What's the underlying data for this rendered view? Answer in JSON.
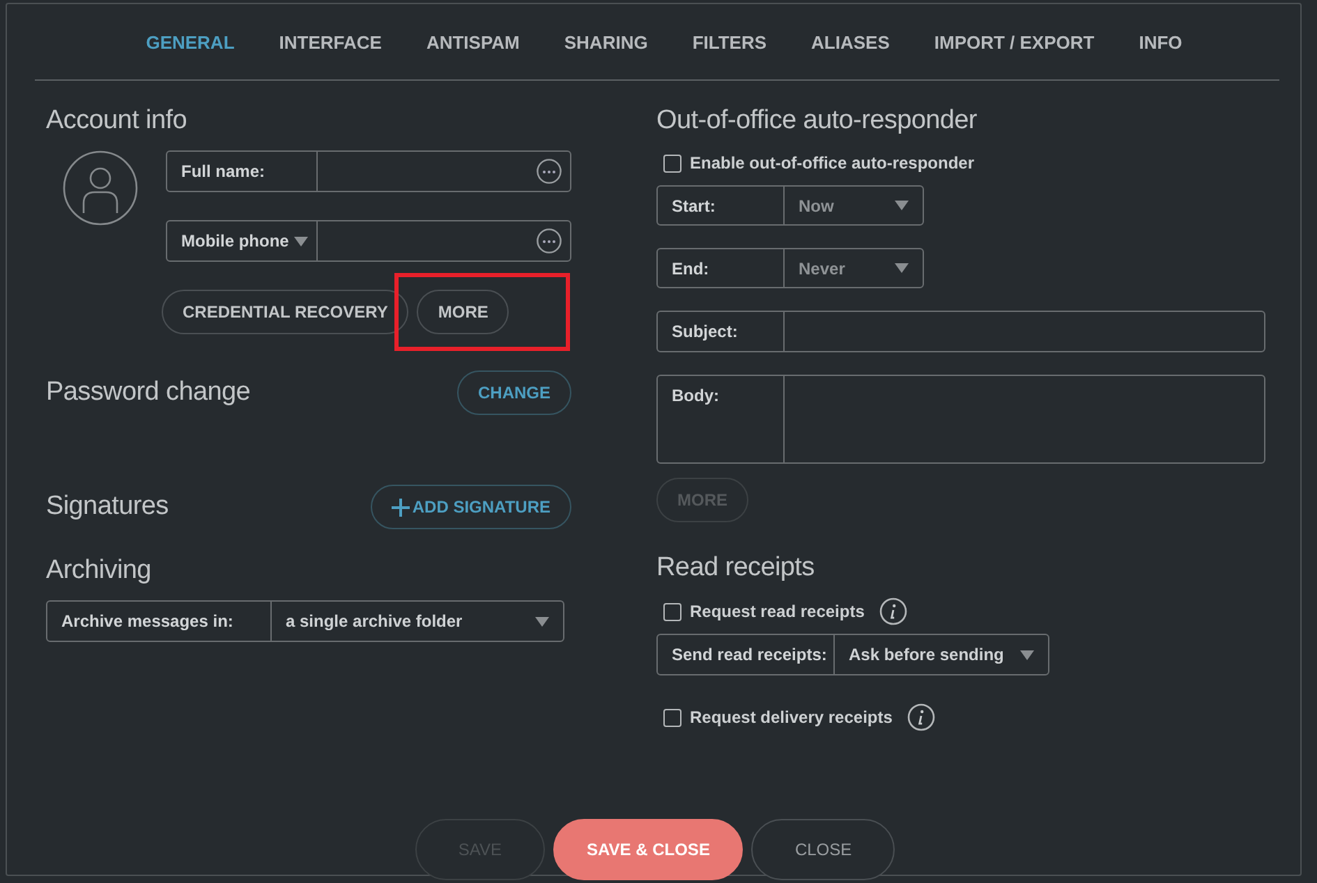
{
  "tabs": [
    {
      "label": "GENERAL",
      "selected": true
    },
    {
      "label": "INTERFACE",
      "selected": false
    },
    {
      "label": "ANTISPAM",
      "selected": false
    },
    {
      "label": "SHARING",
      "selected": false
    },
    {
      "label": "FILTERS",
      "selected": false
    },
    {
      "label": "ALIASES",
      "selected": false
    },
    {
      "label": "IMPORT / EXPORT",
      "selected": false
    },
    {
      "label": "INFO",
      "selected": false
    }
  ],
  "account_info": {
    "heading": "Account info",
    "fields": [
      {
        "kind": "text",
        "label": "Full name:"
      },
      {
        "kind": "dropdown-label",
        "label": "Mobile phone"
      }
    ],
    "buttons": [
      {
        "label": "CREDENTIAL RECOVERY",
        "highlighted": false
      },
      {
        "label": "MORE",
        "highlighted": true
      }
    ]
  },
  "password_change": {
    "heading": "Password change",
    "button": "CHANGE"
  },
  "signatures": {
    "heading": "Signatures",
    "button": "ADD SIGNATURE"
  },
  "archiving": {
    "heading": "Archiving",
    "label": "Archive messages in:",
    "value": "a single archive folder"
  },
  "auto_responder": {
    "heading": "Out-of-office auto-responder",
    "enable": {
      "label": "Enable out-of-office auto-responder",
      "checked": false
    },
    "fields": [
      {
        "kind": "select",
        "label": "Start:",
        "value": "Now"
      },
      {
        "kind": "select",
        "label": "End:",
        "value": "Never"
      },
      {
        "kind": "text",
        "label": "Subject:"
      },
      {
        "kind": "textarea",
        "label": "Body:"
      }
    ],
    "more_button": {
      "label": "MORE",
      "disabled": true
    }
  },
  "read_receipts": {
    "heading": "Read receipts",
    "items": [
      {
        "kind": "checkbox",
        "label": "Request read receipts",
        "checked": false
      },
      {
        "kind": "select",
        "label": "Send read receipts:",
        "value": "Ask before sending"
      },
      {
        "kind": "checkbox",
        "label": "Request delivery receipts",
        "checked": false
      }
    ]
  },
  "footer": [
    {
      "kind": "secondary",
      "label": "SAVE",
      "disabled": true
    },
    {
      "kind": "primary",
      "label": "SAVE & CLOSE",
      "disabled": false
    },
    {
      "kind": "secondary",
      "label": "CLOSE",
      "disabled": false
    }
  ]
}
